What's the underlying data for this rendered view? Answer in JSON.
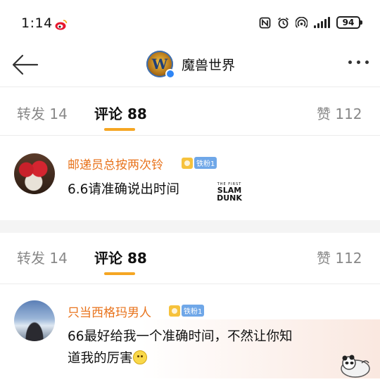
{
  "status_bar": {
    "time": "1:14",
    "battery": "94",
    "icons": [
      "weibo-icon",
      "nfc-icon",
      "alarm-icon",
      "hotspot-icon",
      "signal-icon",
      "battery-icon"
    ]
  },
  "header": {
    "title": "魔兽世界",
    "avatar_letter": "W",
    "back_icon": "arrow-left-icon",
    "more_icon": "more-dots-icon"
  },
  "panels": [
    {
      "tabs": {
        "repost": "转发 14",
        "comment": "评论 88",
        "like": "赞 112"
      },
      "comment": {
        "user": "邮递员总按两次铃",
        "badge": "铁粉1",
        "text": "6.6请准确说出时间",
        "sticker_top": "THE FIRST",
        "sticker_line1": "SLAM",
        "sticker_line2": "DUNK"
      }
    },
    {
      "tabs": {
        "repost": "转发 14",
        "comment": "评论 88",
        "like": "赞 112"
      },
      "comment": {
        "user": "只当西格玛男人",
        "badge": "铁粉1",
        "text_line1": "66最好给我一个准确时间，不然让你知",
        "text_line2": "道我的厉害"
      }
    }
  ],
  "colors": {
    "accent": "#f5a623",
    "username": "#e8731c",
    "verify": "#2f86f6",
    "fan_badge": "#6fa7e8"
  }
}
